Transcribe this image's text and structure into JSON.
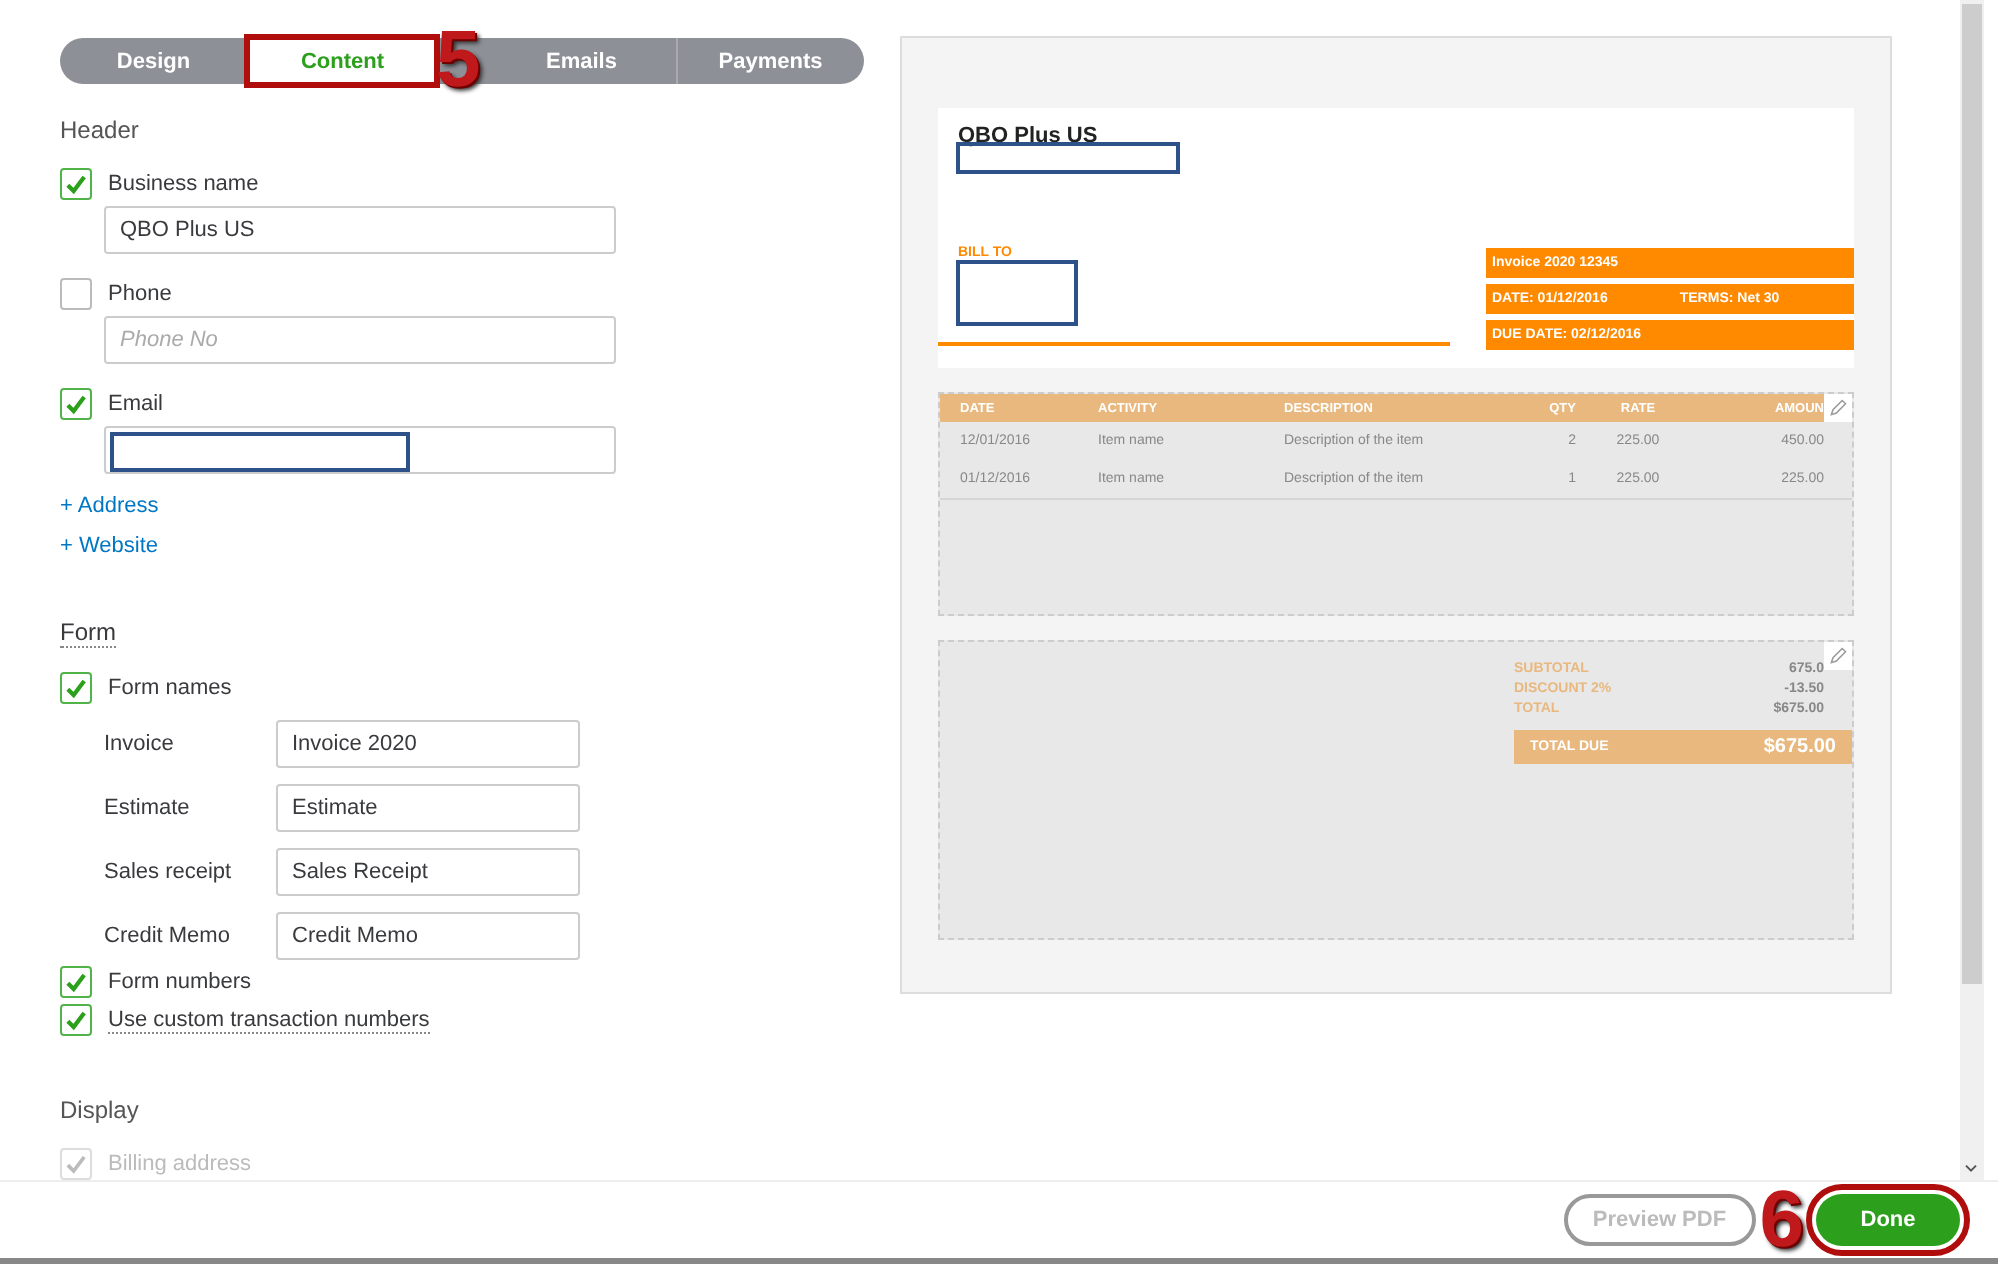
{
  "tabs": [
    {
      "label": "Design",
      "selected": false
    },
    {
      "label": "Content",
      "selected": true
    },
    {
      "label": "Emails",
      "selected": false
    },
    {
      "label": "Payments",
      "selected": false
    }
  ],
  "tabs_callout": "5",
  "header": {
    "title": "Header",
    "fields": [
      {
        "label": "Business name",
        "checked": true,
        "value": "QBO Plus US"
      },
      {
        "label": "Phone",
        "checked": false,
        "placeholder": "Phone No"
      },
      {
        "label": "Email",
        "checked": true,
        "redacted": true
      }
    ],
    "links": [
      "+ Address",
      "+ Website"
    ]
  },
  "form": {
    "title": "Form",
    "names_option": {
      "label": "Form names",
      "checked": true
    },
    "names": [
      {
        "label": "Invoice",
        "value": "Invoice 2020"
      },
      {
        "label": "Estimate",
        "value": "Estimate"
      },
      {
        "label": "Sales receipt",
        "value": "Sales Receipt"
      },
      {
        "label": "Credit Memo",
        "value": "Credit Memo"
      }
    ],
    "options": [
      {
        "label": "Form numbers",
        "checked": true,
        "underlined": false
      },
      {
        "label": "Use custom transaction numbers",
        "checked": true,
        "underlined": true
      }
    ]
  },
  "display": {
    "title": "Display",
    "options": [
      {
        "label": "Billing address",
        "checked": true,
        "disabled": true
      }
    ]
  },
  "preview": {
    "company": "QBO Plus US",
    "bill_to": "BILL TO",
    "invoice_line": "Invoice 2020  12345",
    "date": "DATE:  01/12/2016",
    "terms": "TERMS:  Net 30",
    "due_date": "DUE DATE: 02/12/2016",
    "columns": [
      "DATE",
      "ACTIVITY",
      "DESCRIPTION",
      "QTY",
      "RATE",
      "AMOUN"
    ],
    "rows": [
      [
        "12/01/2016",
        "Item name",
        "Description of the item",
        "2",
        "225.00",
        "450.00"
      ],
      [
        "01/12/2016",
        "Item name",
        "Description of the item",
        "1",
        "225.00",
        "225.00"
      ]
    ],
    "totals": [
      {
        "label": "SUBTOTAL",
        "value": "675.0"
      },
      {
        "label": "DISCOUNT 2%",
        "value": "-13.50"
      },
      {
        "label": "TOTAL",
        "value": "$675.00"
      }
    ],
    "total_due": {
      "label": "TOTAL DUE",
      "value": "$675.00"
    }
  },
  "footer": {
    "buttons": [
      {
        "label": "Preview PDF",
        "kind": "secondary"
      },
      {
        "label": "Done",
        "kind": "primary"
      }
    ],
    "callout": "6"
  }
}
